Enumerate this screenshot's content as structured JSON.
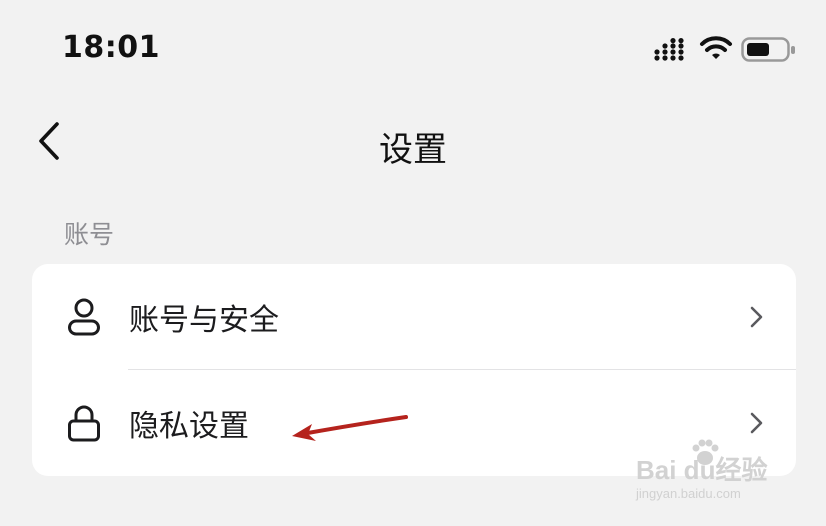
{
  "status_bar": {
    "time": "18:01",
    "icons": [
      "cellular-signal-icon",
      "wifi-icon",
      "battery-icon"
    ]
  },
  "nav": {
    "title": "设置",
    "back_icon": "chevron-left-icon"
  },
  "section": {
    "label": "账号"
  },
  "settings_list": [
    {
      "label": "账号与安全",
      "icon": "user-icon",
      "trailing_icon": "chevron-right-icon"
    },
    {
      "label": "隐私设置",
      "icon": "lock-icon",
      "trailing_icon": "chevron-right-icon"
    }
  ],
  "annotation": {
    "arrow_color": "#b5231d"
  },
  "watermark": {
    "main": "Bai du经验",
    "sub": "jingyan.baidu.com"
  }
}
